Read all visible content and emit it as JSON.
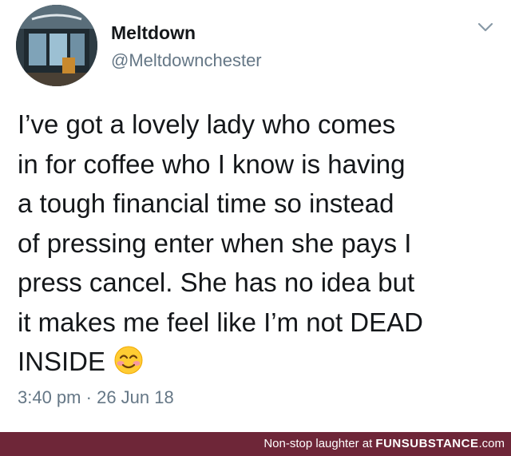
{
  "tweet": {
    "display_name": "Meltdown",
    "handle": "@Meltdownchester",
    "text_lines": [
      "I’ve got a lovely lady who comes",
      "in for coffee who I know is having",
      "a tough financial time so instead",
      "of pressing enter when she pays I",
      "press cancel. She has no idea but",
      "it makes me feel like I’m not DEAD",
      "INSIDE"
    ],
    "emoji": "smiling-face-with-smiling-eyes-icon",
    "time": "3:40 pm",
    "separator": "·",
    "date": "26 Jun 18"
  },
  "footer": {
    "tagline": "Non-stop laughter at",
    "brand_bold": "FUNSUBSTANCE",
    "brand_domain": ".com"
  },
  "colors": {
    "text": "#14171a",
    "muted": "#657786",
    "footer_bg": "#6e2638",
    "footer_text": "#ffffff"
  }
}
